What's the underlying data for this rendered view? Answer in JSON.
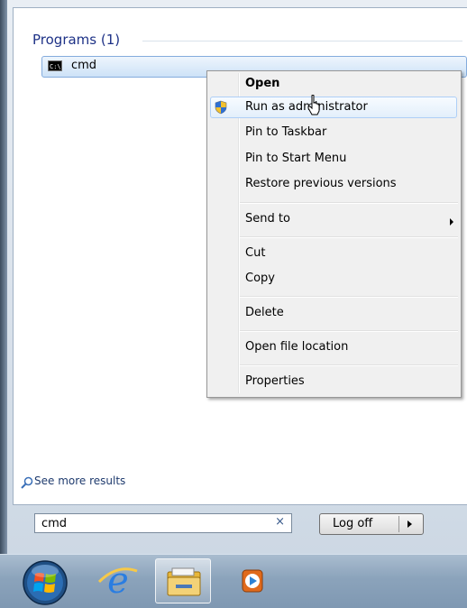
{
  "start_menu": {
    "programs_header": "Programs (1)",
    "result_item": "cmd",
    "see_more": "See more results",
    "search_value": "cmd",
    "clear_glyph": "×",
    "logoff_label": "Log off"
  },
  "context_menu": {
    "items": [
      {
        "label": "Open",
        "bold": true
      },
      {
        "label": "Run as administrator",
        "icon": "uac-shield-icon",
        "highlighted": true
      },
      {
        "label": "Pin to Taskbar"
      },
      {
        "label": "Pin to Start Menu"
      },
      {
        "label": "Restore previous versions"
      },
      {
        "label": "Send to",
        "submenu": true
      },
      {
        "label": "Cut"
      },
      {
        "label": "Copy"
      },
      {
        "label": "Delete"
      },
      {
        "label": "Open file location"
      },
      {
        "label": "Properties"
      }
    ]
  },
  "taskbar": {
    "items": [
      "start-orb",
      "internet-explorer-icon",
      "windows-explorer-icon",
      "media-player-icon"
    ]
  },
  "colors": {
    "header_text": "#1e3287",
    "highlight_border": "#aecff7",
    "taskbar": "#8ba3bb"
  }
}
